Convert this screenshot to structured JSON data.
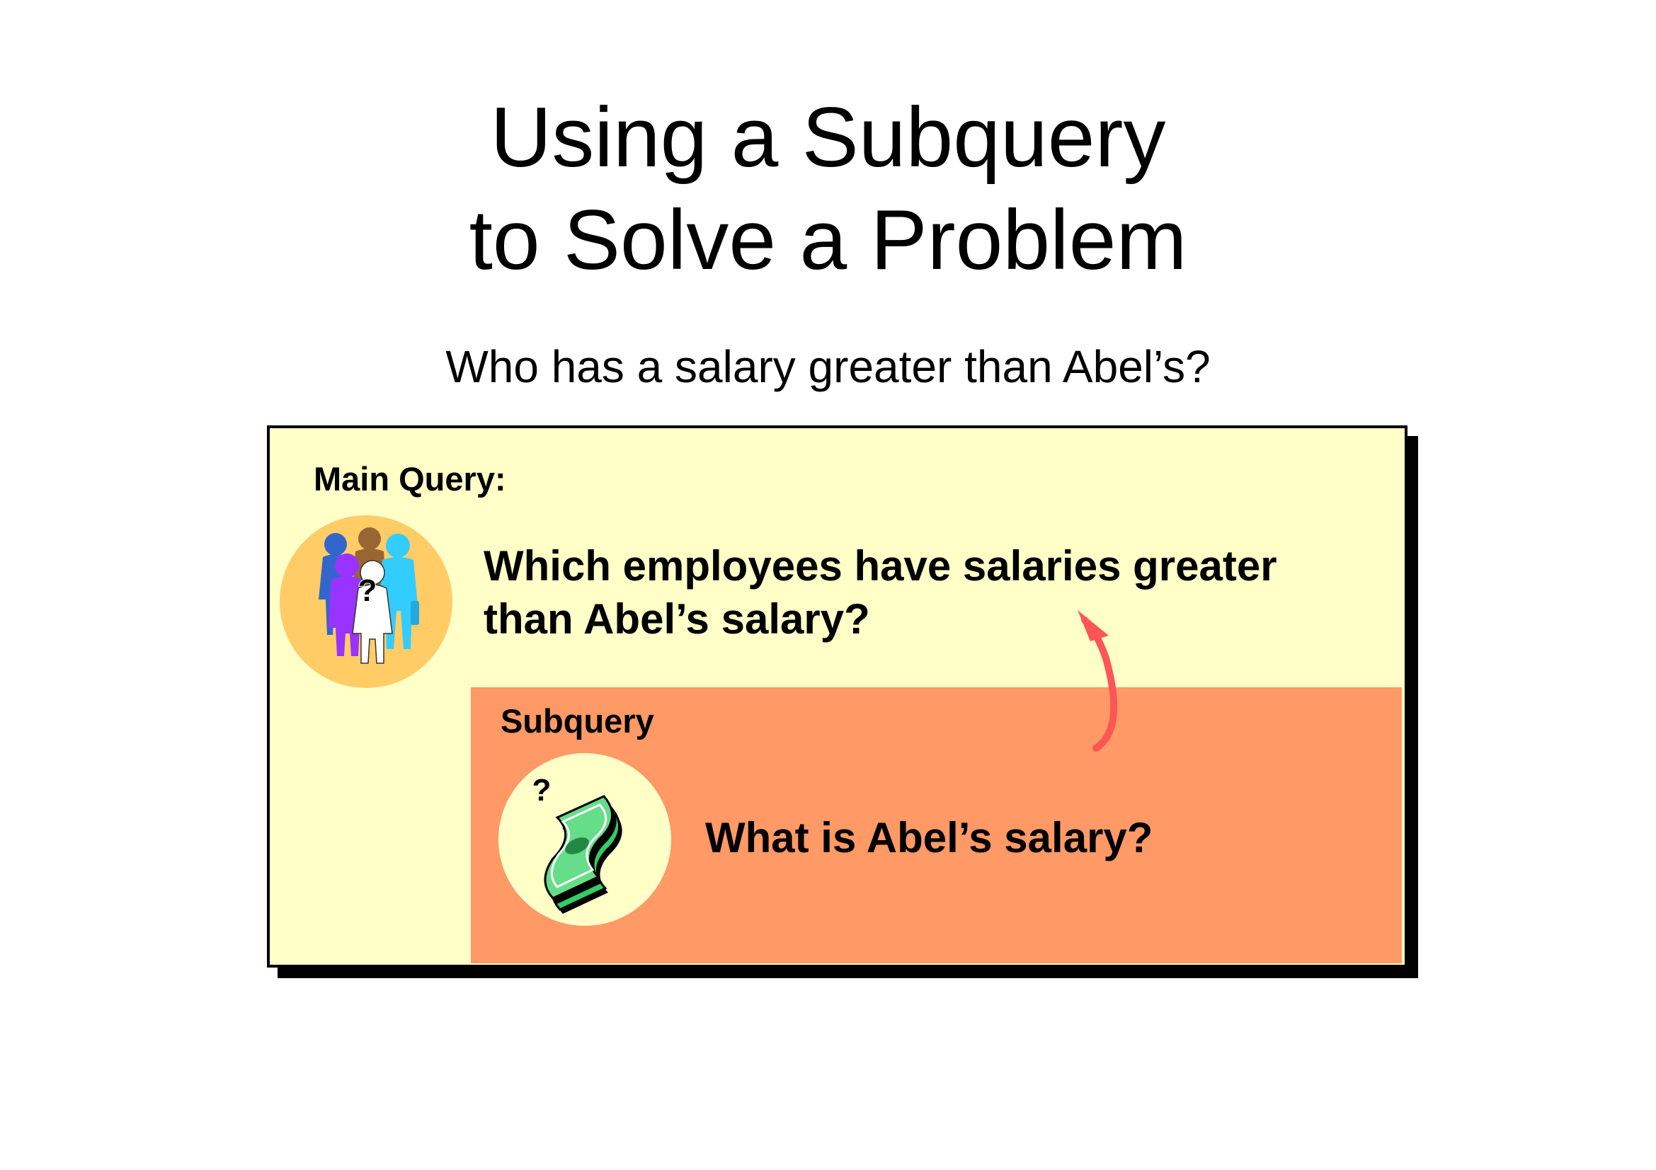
{
  "title": {
    "line1": "Using a Subquery",
    "line2": "to Solve a Problem"
  },
  "question": "Who has a salary greater than Abel’s?",
  "main_query": {
    "label": "Main Query:",
    "text_line1": "Which employees have salaries greater",
    "text_line2": "than Abel’s salary?",
    "icon": "people-question-icon",
    "mark": "?"
  },
  "subquery": {
    "label": "Subquery",
    "text": "What is Abel’s salary?",
    "icon": "money-question-icon",
    "mark": "?"
  },
  "colors": {
    "main_box": "#ffffc8",
    "sub_box": "#ff9966",
    "people_circle": "#ffcc66",
    "money_circle": "#ffffc8",
    "arrow": "#ff5555"
  }
}
